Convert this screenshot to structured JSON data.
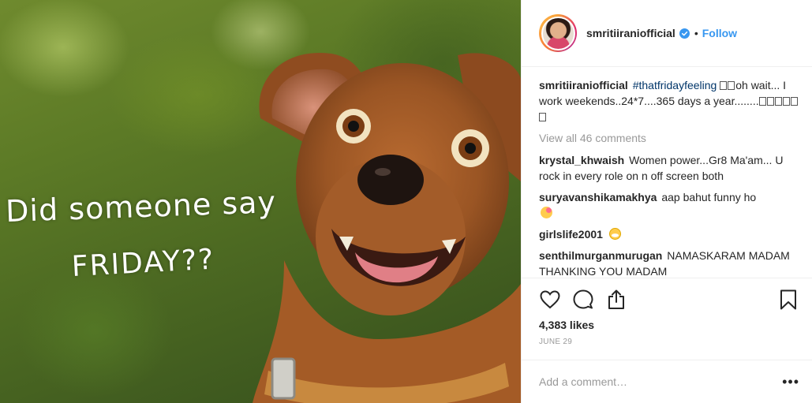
{
  "photo": {
    "caption_line1": "Did someone say",
    "caption_line2": "FRIDAY??"
  },
  "header": {
    "username": "smritiiraniofficial",
    "separator": "•",
    "follow_label": "Follow"
  },
  "caption": {
    "username": "smritiiraniofficial",
    "hashtag": "#thatfridayfeeling",
    "text": "oh wait... I work weekends..24*7....365 days a year........"
  },
  "view_all_label": "View all 46 comments",
  "comments": [
    {
      "username": "krystal_khwaish",
      "text": "Women power...Gr8 Ma'am... U rock in every role on n off screen both"
    },
    {
      "username": "suryavanshikamakhya",
      "text": "aap bahut funny ho"
    },
    {
      "username": "girlslife2001",
      "text": ""
    },
    {
      "username": "senthilmurganmurugan",
      "text": "NAMASKARAM MADAM THANKING YOU MADAM"
    }
  ],
  "likes": "4,383 likes",
  "date": "JUNE 29",
  "add_comment_placeholder": "Add a comment…",
  "more_label": "•••",
  "colors": {
    "link": "#3897f0",
    "hashtag": "#003569",
    "muted": "#999999",
    "verified": "#3897f0"
  },
  "icons": [
    "verified-badge-icon",
    "heart-icon",
    "comment-icon",
    "share-icon",
    "bookmark-icon",
    "more-icon"
  ]
}
